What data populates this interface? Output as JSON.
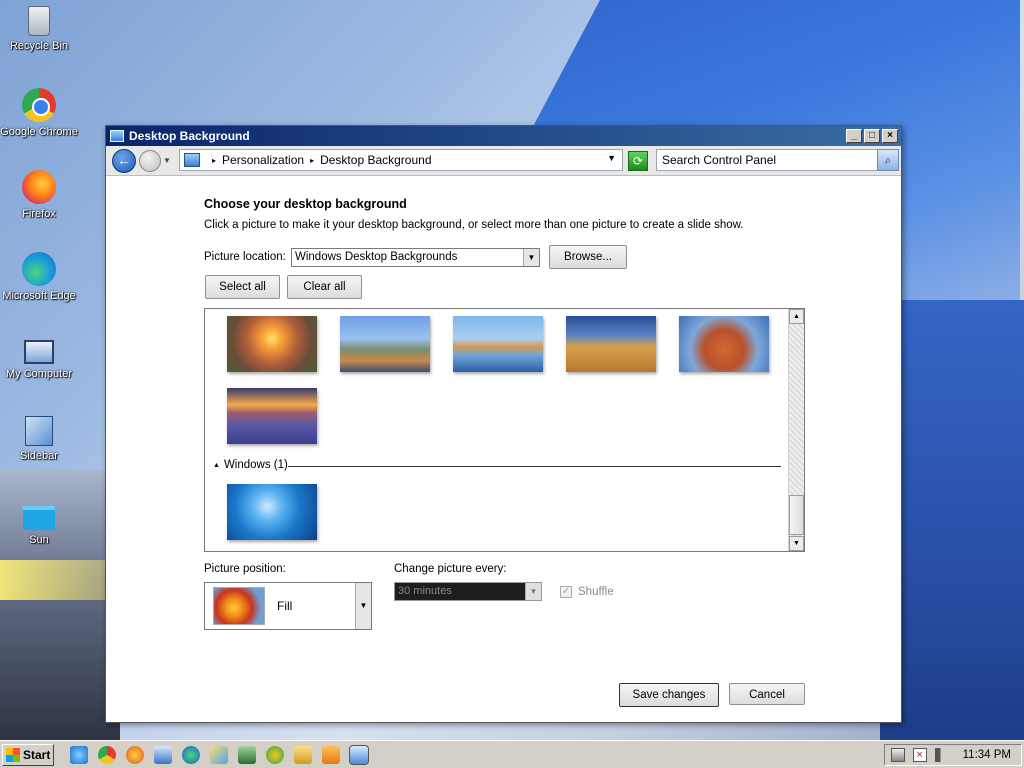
{
  "desktop": {
    "icons": [
      {
        "label": "Recycle Bin"
      },
      {
        "label": "Google Chrome"
      },
      {
        "label": "Firefox"
      },
      {
        "label": "Microsoft Edge"
      },
      {
        "label": "My Computer"
      },
      {
        "label": "Sidebar"
      },
      {
        "label": "Sun"
      }
    ]
  },
  "window": {
    "title": "Desktop Background",
    "controls": {
      "minimize": "_",
      "maximize": "□",
      "close": "×"
    },
    "nav": {
      "back_icon": "back-arrow-icon",
      "breadcrumb": [
        "Personalization",
        "Desktop Background"
      ],
      "breadcrumb_separator": "▸",
      "search_placeholder": "Search Control Panel",
      "search_icon": "search-icon"
    },
    "heading": "Choose your desktop background",
    "subtext": "Click a picture to make it your desktop background, or select more than one picture to create a slide show.",
    "picture_location": {
      "label": "Picture location:",
      "value": "Windows Desktop Backgrounds"
    },
    "buttons": {
      "browse": "Browse...",
      "select_all": "Select all",
      "clear_all": "Clear all",
      "save": "Save changes",
      "cancel": "Cancel"
    },
    "gallery": {
      "thumbnails_count": 7,
      "group_label": "Windows (1)"
    },
    "picture_position": {
      "label": "Picture position:",
      "value": "Fill"
    },
    "change_every": {
      "label": "Change picture every:",
      "value": "30 minutes",
      "enabled": false
    },
    "shuffle": {
      "label": "Shuffle",
      "checked": true,
      "enabled": false
    }
  },
  "taskbar": {
    "start_label": "Start",
    "clock": "11:34 PM",
    "quick_icons": [
      "ie-icon",
      "chrome-icon",
      "firefox-icon",
      "control-panel-icon",
      "edge-icon",
      "paint-icon",
      "network-icon",
      "chrome-alt-icon",
      "explorer-icon",
      "media-player-icon",
      "desktop-background-window-icon"
    ]
  },
  "colors": {
    "titlebar_start": "#0a246a",
    "titlebar_end": "#3a6ea5",
    "taskbar": "#d4d0c8"
  }
}
